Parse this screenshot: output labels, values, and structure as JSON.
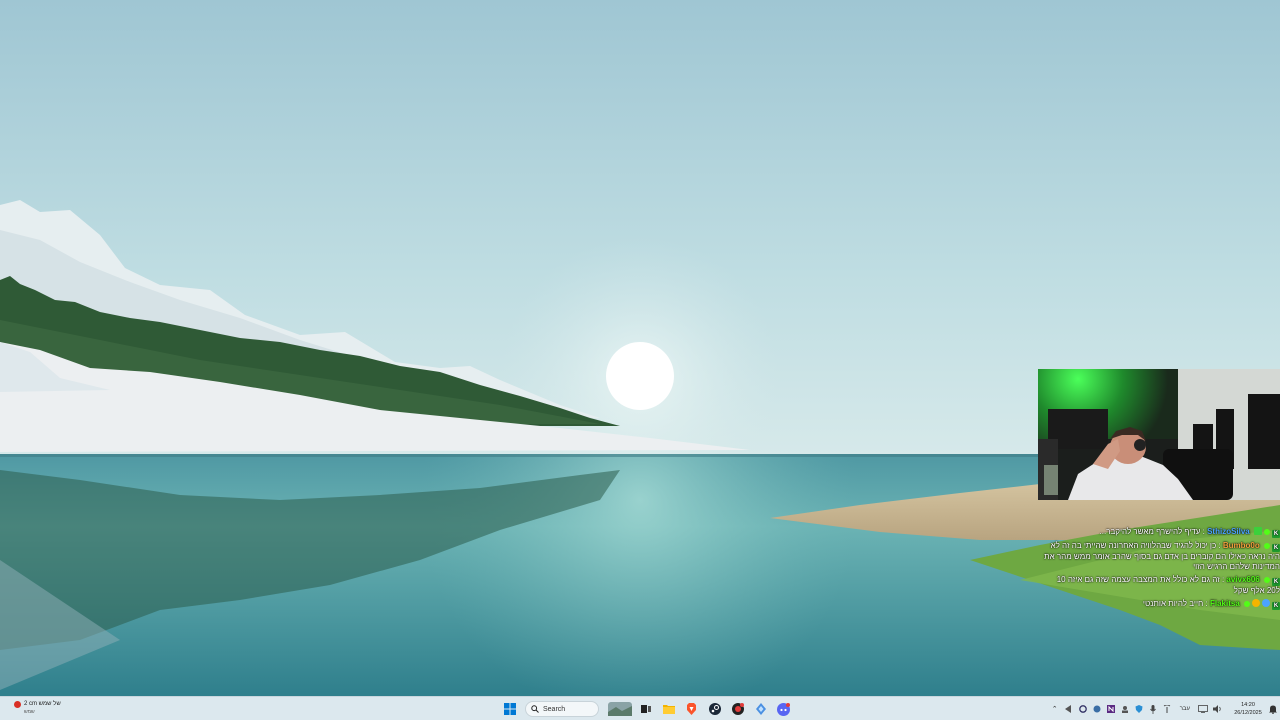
{
  "wallpaper": {
    "name": "Windows 11 lake landscape",
    "sky_color": "#a9cdd8",
    "water_color": "#3f8f98"
  },
  "webcam": {
    "accent_color": "#33ff44"
  },
  "chat": {
    "messages": [
      {
        "user": "SthizoSilva",
        "user_color": "#4ba3ff",
        "text": "עדיף להישרף מאשר להיקבר...",
        "badges": [
          "k-icon",
          "gem-icon",
          "gift-icon"
        ]
      },
      {
        "user": "Bumbo0o",
        "user_color": "#f2a03c",
        "text": "כן יכול להגיד שבהלוויה האחרונה שהייתי בה זה לא היה נראה כאילו הם קוברים בן אדם גם בסוף שהרב אומר ממש מהר את המדינות שלהם הרגיש הזוי",
        "badges": [
          "k-icon",
          "gem-icon"
        ]
      },
      {
        "user": "avivx606",
        "user_color": "#53fc18",
        "text": "זה גם לא כולל את המצבה עצמה שזה גם איזה 10 ל20 אלף שקל",
        "badges": [
          "k-icon",
          "gem-icon"
        ]
      },
      {
        "user": "Flakitsa",
        "user_color": "#53fc18",
        "text": "חייב להיות אותנטי",
        "badges": [
          "k-icon",
          "blue-circle-icon",
          "gold-coin-icon",
          "gem-icon"
        ]
      }
    ]
  },
  "taskbar": {
    "weather": {
      "temp": "2 cm של שמש",
      "desc": "שמש"
    },
    "search_label": "Search",
    "pinned": [
      "start-icon",
      "search-box",
      "widget-icon",
      "task-view-icon",
      "file-explorer-icon",
      "brave-icon",
      "steam-icon",
      "app-red-icon",
      "app-blue-icon",
      "discord-icon"
    ],
    "tray": {
      "lang": "עבר",
      "time": "14:20",
      "date": "26/12/2025"
    }
  }
}
